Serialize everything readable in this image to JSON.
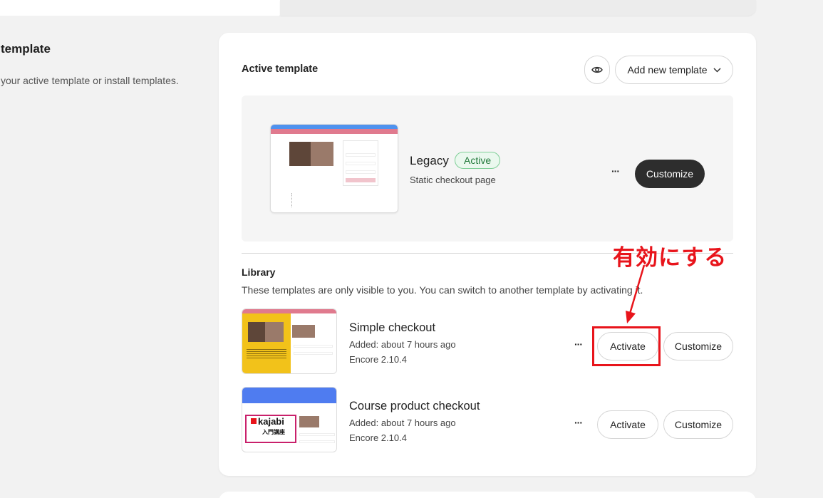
{
  "left": {
    "title": "template",
    "description": "your active template or install templates."
  },
  "active": {
    "heading": "Active template",
    "preview_icon": "eye-icon",
    "add_button_label": "Add new template",
    "add_button_icon": "chevron-down-icon",
    "template": {
      "name": "Legacy",
      "badge": "Active",
      "description": "Static checkout page",
      "more_label": "···",
      "customize_label": "Customize"
    }
  },
  "library": {
    "heading": "Library",
    "description": "These templates are only visible to you. You can switch to another template by activating it.",
    "items": [
      {
        "name": "Simple checkout",
        "added": "Added: about 7 hours ago",
        "version": "Encore 2.10.4",
        "more_label": "···",
        "activate_label": "Activate",
        "customize_label": "Customize"
      },
      {
        "name": "Course product checkout",
        "added": "Added: about 7 hours ago",
        "version": "Encore 2.10.4",
        "more_label": "···",
        "activate_label": "Activate",
        "customize_label": "Customize",
        "thumb_logo": "kajabi",
        "thumb_logo_sub": "入門講座"
      }
    ]
  },
  "annotation": {
    "text": "有効にする",
    "color": "#e8141b"
  },
  "colors": {
    "background": "#f2f2f2",
    "dark_button": "#2d2d2d",
    "active_badge_bg": "#eaf8ee",
    "active_badge_text": "#237a3c"
  }
}
